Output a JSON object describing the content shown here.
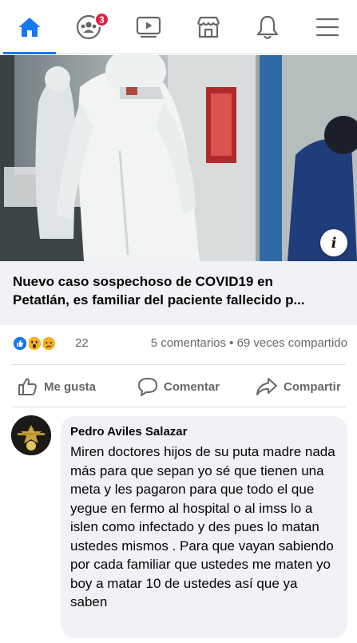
{
  "nav": {
    "items": [
      {
        "name": "home",
        "icon": "home-icon",
        "active": true
      },
      {
        "name": "groups",
        "icon": "groups-icon",
        "badge": "3"
      },
      {
        "name": "watch",
        "icon": "video-icon"
      },
      {
        "name": "marketplace",
        "icon": "marketplace-icon"
      },
      {
        "name": "notifications",
        "icon": "bell-icon"
      },
      {
        "name": "menu",
        "icon": "hamburger-menu-icon"
      }
    ],
    "accent": "#1877f2",
    "badge_color": "#e41e3f"
  },
  "post": {
    "headline": "Nuevo caso sospechoso de COVID19 en Petatlán, es familiar del paciente fallecido p...",
    "reactions": {
      "types": [
        "like",
        "wow",
        "sad"
      ],
      "count": "22"
    },
    "comments_shares": "5 comentarios • 69 veces compartido",
    "actions": {
      "like": "Me gusta",
      "comment": "Comentar",
      "share": "Compartir"
    }
  },
  "comment": {
    "author": "Pedro Aviles Salazar",
    "text": "Miren doctores hijos de su puta madre nada más para que sepan yo sé que tienen una meta y les pagaron para que todo el que yegue en fermo al hospital o al imss lo a islen como infectado y des pues lo matan ustedes mismos . Para que vayan sabiendo por cada familiar que ustedes me maten yo boy a matar 10 de ustedes así que ya saben"
  }
}
